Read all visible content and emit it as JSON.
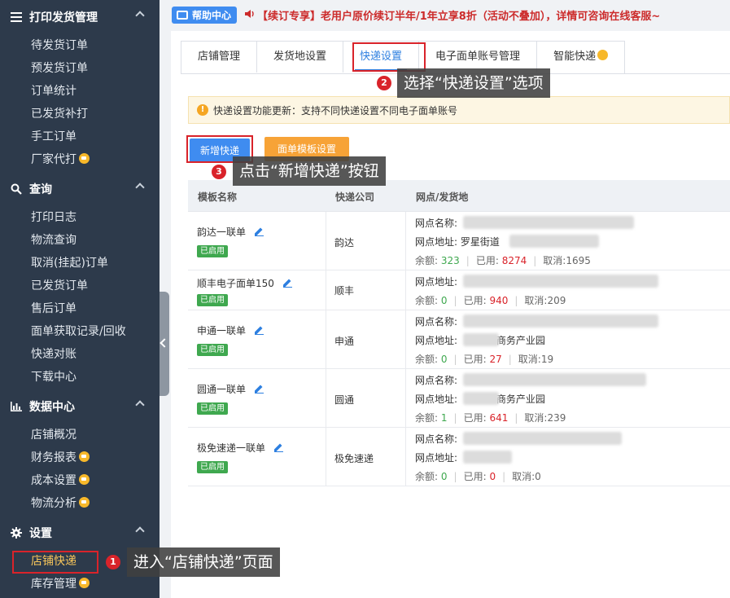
{
  "sidebar": {
    "groups": [
      {
        "label": "打印发货管理",
        "icon": "menu-icon",
        "items": [
          {
            "label": "待发货订单"
          },
          {
            "label": "预发货订单"
          },
          {
            "label": "订单统计"
          },
          {
            "label": "已发货补打"
          },
          {
            "label": "手工订单"
          },
          {
            "label": "厂家代打",
            "badge": true
          }
        ]
      },
      {
        "label": "查询",
        "icon": "search-icon",
        "items": [
          {
            "label": "打印日志"
          },
          {
            "label": "物流查询"
          },
          {
            "label": "取消(挂起)订单"
          },
          {
            "label": "已发货订单"
          },
          {
            "label": "售后订单"
          },
          {
            "label": "面单获取记录/回收"
          },
          {
            "label": "快递对账"
          },
          {
            "label": "下载中心"
          }
        ]
      },
      {
        "label": "数据中心",
        "icon": "bar-chart-icon",
        "items": [
          {
            "label": "店铺概况"
          },
          {
            "label": "财务报表",
            "badge": true
          },
          {
            "label": "成本设置",
            "badge": true
          },
          {
            "label": "物流分析",
            "badge": true
          }
        ]
      },
      {
        "label": "设置",
        "icon": "gear-icon",
        "items": [
          {
            "label": "店铺快递",
            "active": true
          },
          {
            "label": "库存管理",
            "badge": true
          }
        ]
      }
    ]
  },
  "topbar": {
    "help_label": "帮助中心",
    "notice": "【续订专享】老用户原价续订半年/1年立享8折（活动不叠加），详情可咨询在线客服~"
  },
  "tabs": [
    {
      "label": "店铺管理"
    },
    {
      "label": "发货地设置"
    },
    {
      "label": "快递设置",
      "active": true
    },
    {
      "label": "电子面单账号管理"
    },
    {
      "label": "智能快递",
      "badge": true
    }
  ],
  "info_bar": {
    "text": "快递设置功能更新：支持不同快递设置不同电子面单账号"
  },
  "buttons": {
    "add": "新增快递",
    "template": "面单模板设置"
  },
  "callouts": {
    "step1": {
      "num": "1",
      "text": "进入“店铺快递”页面"
    },
    "step2": {
      "num": "2",
      "text": "选择“快递设置”选项"
    },
    "step3": {
      "num": "3",
      "text": "点击“新增快递”按钮"
    }
  },
  "table": {
    "headers": [
      "模板名称",
      "快递公司",
      "网点/发货地"
    ],
    "status_label": "已启用",
    "labels": {
      "site_name": "网点名称:",
      "site_addr": "网点地址:",
      "balance": "余额:",
      "used": "已用:",
      "cancelled": "取消:"
    },
    "rows": [
      {
        "name": "韵达一联单",
        "company": "韵达",
        "site_addr_visible": "罗星街道",
        "balance": "323",
        "used": "8274",
        "cancelled": "1695"
      },
      {
        "name": "顺丰电子面单150",
        "company": "顺丰",
        "site_addr_visible": "",
        "balance": "0",
        "used": "940",
        "cancelled": "209"
      },
      {
        "name": "申通一联单",
        "company": "申通",
        "site_addr_visible": "商务产业园",
        "balance": "0",
        "used": "27",
        "cancelled": "19"
      },
      {
        "name": "圆通一联单",
        "company": "圆通",
        "site_addr_visible": "商务产业园",
        "balance": "1",
        "used": "641",
        "cancelled": "239"
      },
      {
        "name": "极免速递一联单",
        "company": "极免速递",
        "site_addr_visible": "",
        "balance": "0",
        "used": "0",
        "cancelled": "0"
      }
    ]
  },
  "colors": {
    "accent": "#3f8cf0",
    "highlight": "#d9232a",
    "sidebar_bg": "#2d3a4b",
    "orange": "#f7a337",
    "green": "#3fa84f"
  }
}
